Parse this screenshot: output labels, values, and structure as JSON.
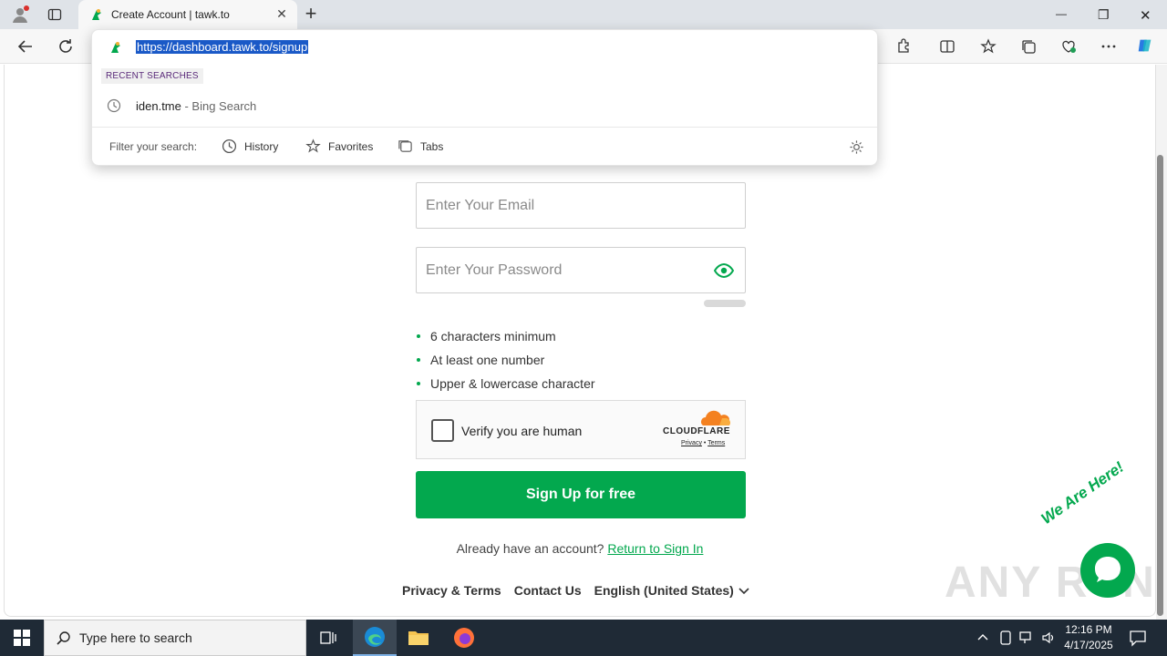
{
  "browser": {
    "tab_title": "Create Account | tawk.to",
    "url": "https://dashboard.tawk.to/signup",
    "tab_close": "✕",
    "new_tab": "+",
    "minimize": "—",
    "restore": "❐",
    "close": "✕"
  },
  "omnibox": {
    "recent_label": "RECENT SEARCHES",
    "recent_item": "iden.tme",
    "recent_item_source": " - Bing Search",
    "filter_label": "Filter your search:",
    "filters": [
      "History",
      "Favorites",
      "Tabs"
    ]
  },
  "form": {
    "email_placeholder": "Enter Your Email",
    "password_placeholder": "Enter Your Password",
    "requirements": [
      "6 characters minimum",
      "At least one number",
      "Upper & lowercase character"
    ],
    "captcha_label": "Verify you are human",
    "captcha_brand": "CLOUDFLARE",
    "captcha_privacy": "Privacy",
    "captcha_sep": " • ",
    "captcha_terms": "Terms",
    "signup_button": "Sign Up for free",
    "already_text": "Already have an account? ",
    "signin_link": "Return to Sign In"
  },
  "footer": {
    "privacy": "Privacy & Terms",
    "contact": "Contact Us",
    "language": "English (United States)"
  },
  "widget": {
    "label": "We Are Here!",
    "watermark": "ANY RUN"
  },
  "taskbar": {
    "search_placeholder": "Type here to search",
    "time": "12:16 PM",
    "date": "4/17/2025"
  },
  "colors": {
    "brand_green": "#03a84e",
    "url_highlight": "#1a59c7",
    "taskbar": "#1f2a36"
  }
}
